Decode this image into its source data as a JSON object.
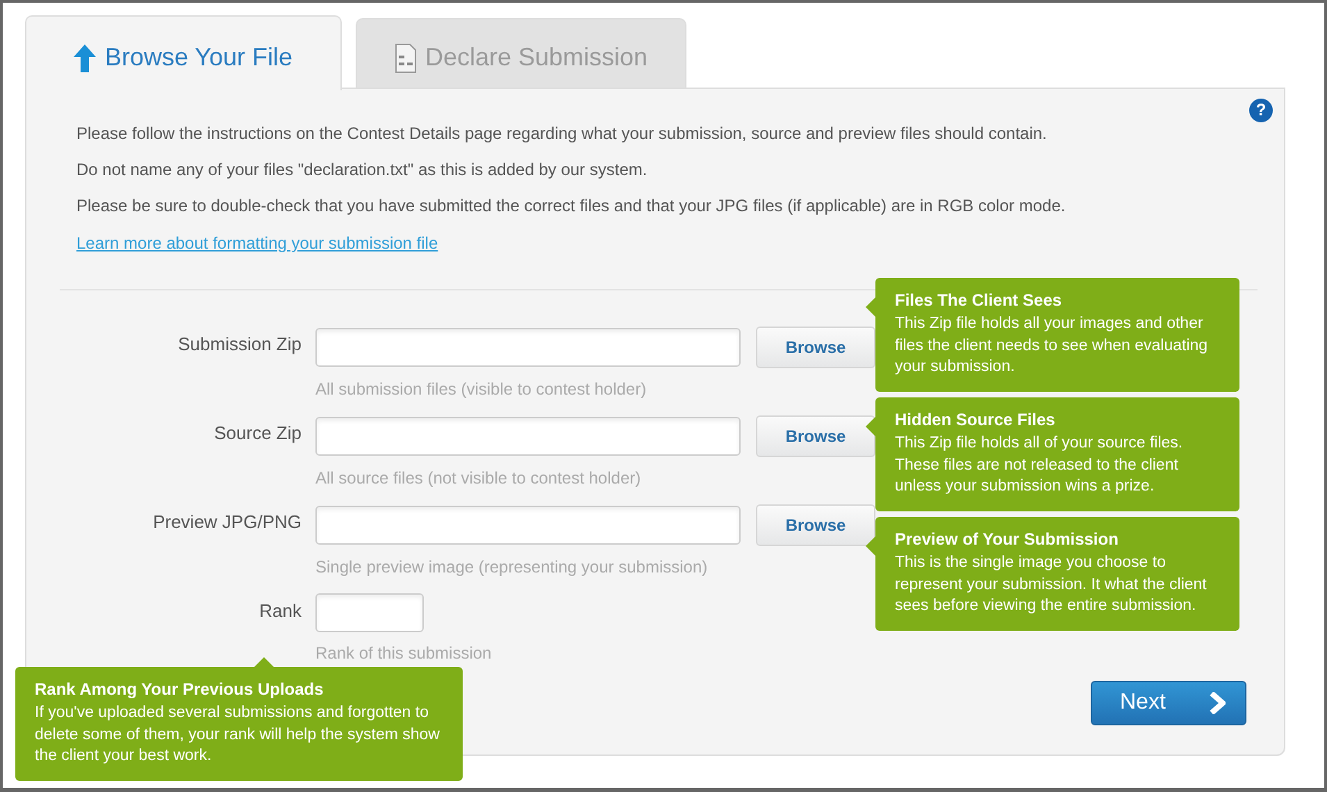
{
  "tabs": [
    {
      "label": "Browse Your File",
      "selected": true,
      "kind": "upload"
    },
    {
      "label": "Declare Submission",
      "selected": false,
      "kind": "document"
    }
  ],
  "help": {
    "label": "?"
  },
  "instructions": [
    "Please follow the instructions on the Contest Details page regarding what your submission, source and preview files should contain.",
    "Do not name any of your files \"declaration.txt\" as this is added by our system.",
    "Please be sure to double-check that you have submitted the correct files and that your JPG files (if applicable) are in RGB color mode."
  ],
  "link": "Learn more about formatting your submission file",
  "fields": [
    {
      "label": "Submission Zip",
      "hint": "All submission files (visible to contest holder)",
      "kind": "file",
      "button": "Browse",
      "tooltip": {
        "title": "Files The Client Sees",
        "body": "This Zip file holds all your images and other files the client needs to see when evaluating your submission."
      }
    },
    {
      "label": "Source Zip",
      "hint": "All source files (not visible to contest holder)",
      "kind": "file",
      "button": "Browse",
      "tooltip": {
        "title": "Hidden Source Files",
        "body": "This Zip file holds all of your source files. These files are not released to the client unless your submission wins a prize."
      }
    },
    {
      "label": "Preview JPG/PNG",
      "hint": "Single preview image (representing your submission)",
      "kind": "file",
      "button": "Browse",
      "tooltip": {
        "title": "Preview of Your Submission",
        "body": "This is the single image you choose to represent your submission. It what the client sees before viewing the entire submission."
      }
    },
    {
      "label": "Rank",
      "hint": "Rank of this submission",
      "kind": "text",
      "tooltip": {
        "title": "Rank Among Your Previous Uploads",
        "body": "If you've uploaded several submissions and forgotten to delete some of them, your rank will help the system show the client your best work."
      }
    }
  ],
  "next_button": "Next"
}
